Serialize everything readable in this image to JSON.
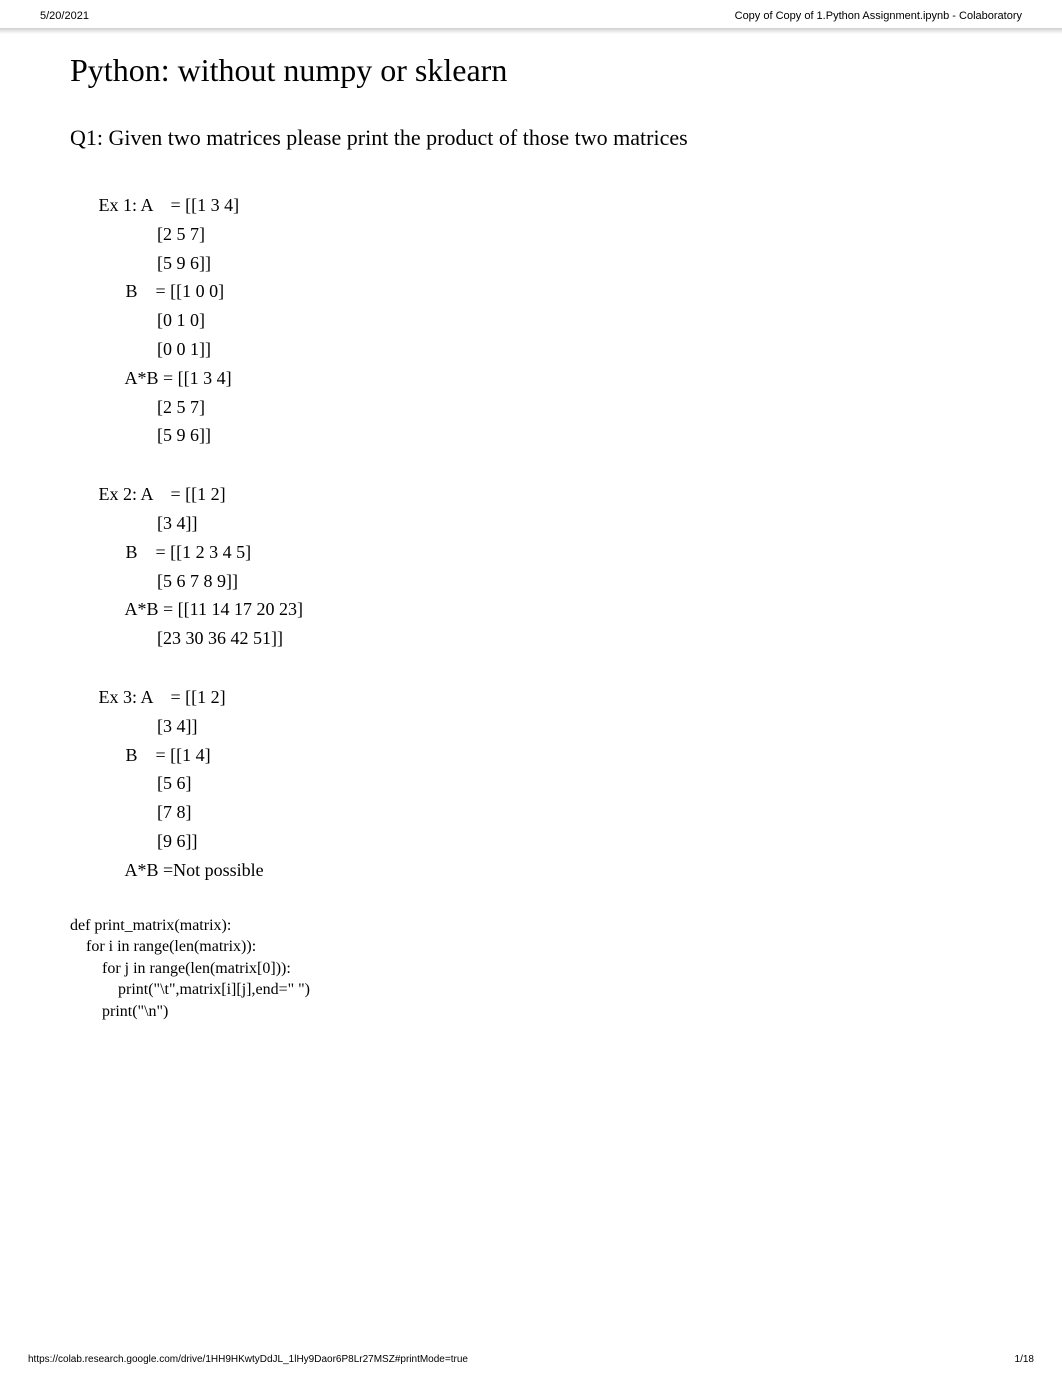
{
  "header": {
    "date": "5/20/2021",
    "title": "Copy of Copy of 1.Python Assignment.ipynb - Colaboratory"
  },
  "main": {
    "title": "Python: without numpy or sklearn",
    "subtitle": "Q1: Given two matrices please print the product of those two matrices",
    "example1": " Ex 1: A    = [[1 3 4]\n              [2 5 7]\n              [5 9 6]]\n       B    = [[1 0 0]\n              [0 1 0]\n              [0 0 1]]\n       A*B = [[1 3 4]\n              [2 5 7]\n              [5 9 6]]",
    "example2": " Ex 2: A    = [[1 2]\n              [3 4]]\n       B    = [[1 2 3 4 5]\n              [5 6 7 8 9]]\n       A*B = [[11 14 17 20 23]\n              [23 30 36 42 51]]",
    "example3": " Ex 3: A    = [[1 2]\n              [3 4]]\n       B    = [[1 4]\n              [5 6]\n              [7 8]\n              [9 6]]\n       A*B =Not possible",
    "code": "def print_matrix(matrix):\n    for i in range(len(matrix)):\n        for j in range(len(matrix[0])):\n            print(\"\\t\",matrix[i][j],end=\" \")\n        print(\"\\n\")"
  },
  "footer": {
    "url": "https://colab.research.google.com/drive/1HH9HKwtyDdJL_1lHy9Daor6P8Lr27MSZ#printMode=true",
    "page": "1/18"
  }
}
